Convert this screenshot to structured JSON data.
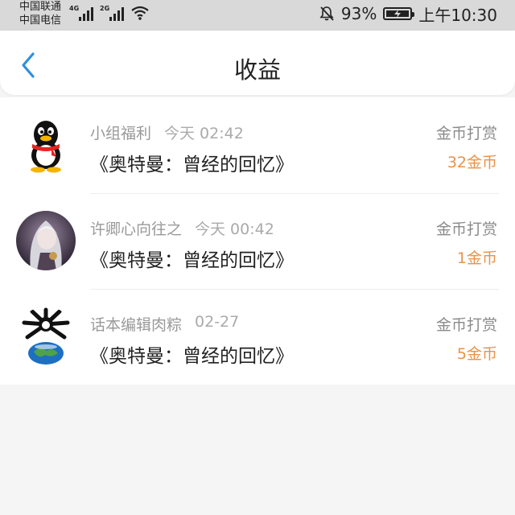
{
  "status_bar": {
    "carrier1": "中国联通",
    "carrier2": "中国电信",
    "sim1_net": "4G",
    "sim2_net": "2G",
    "battery": "93%",
    "time": "上午10:30"
  },
  "header": {
    "title": "收益"
  },
  "rewards": [
    {
      "user": "小组福利",
      "time": "今天 02:42",
      "book": "《奥特曼：曾经的回忆》",
      "type": "金币打赏",
      "amount": "32金币"
    },
    {
      "user": "许卿心向往之",
      "time": "今天 00:42",
      "book": "《奥特曼：曾经的回忆》",
      "type": "金币打赏",
      "amount": "1金币"
    },
    {
      "user": "话本编辑肉粽",
      "time": "02-27",
      "book": "《奥特曼：曾经的回忆》",
      "type": "金币打赏",
      "amount": "5金币"
    }
  ],
  "colors": {
    "accent": "#2f8fe0",
    "amount": "#e8934a"
  }
}
